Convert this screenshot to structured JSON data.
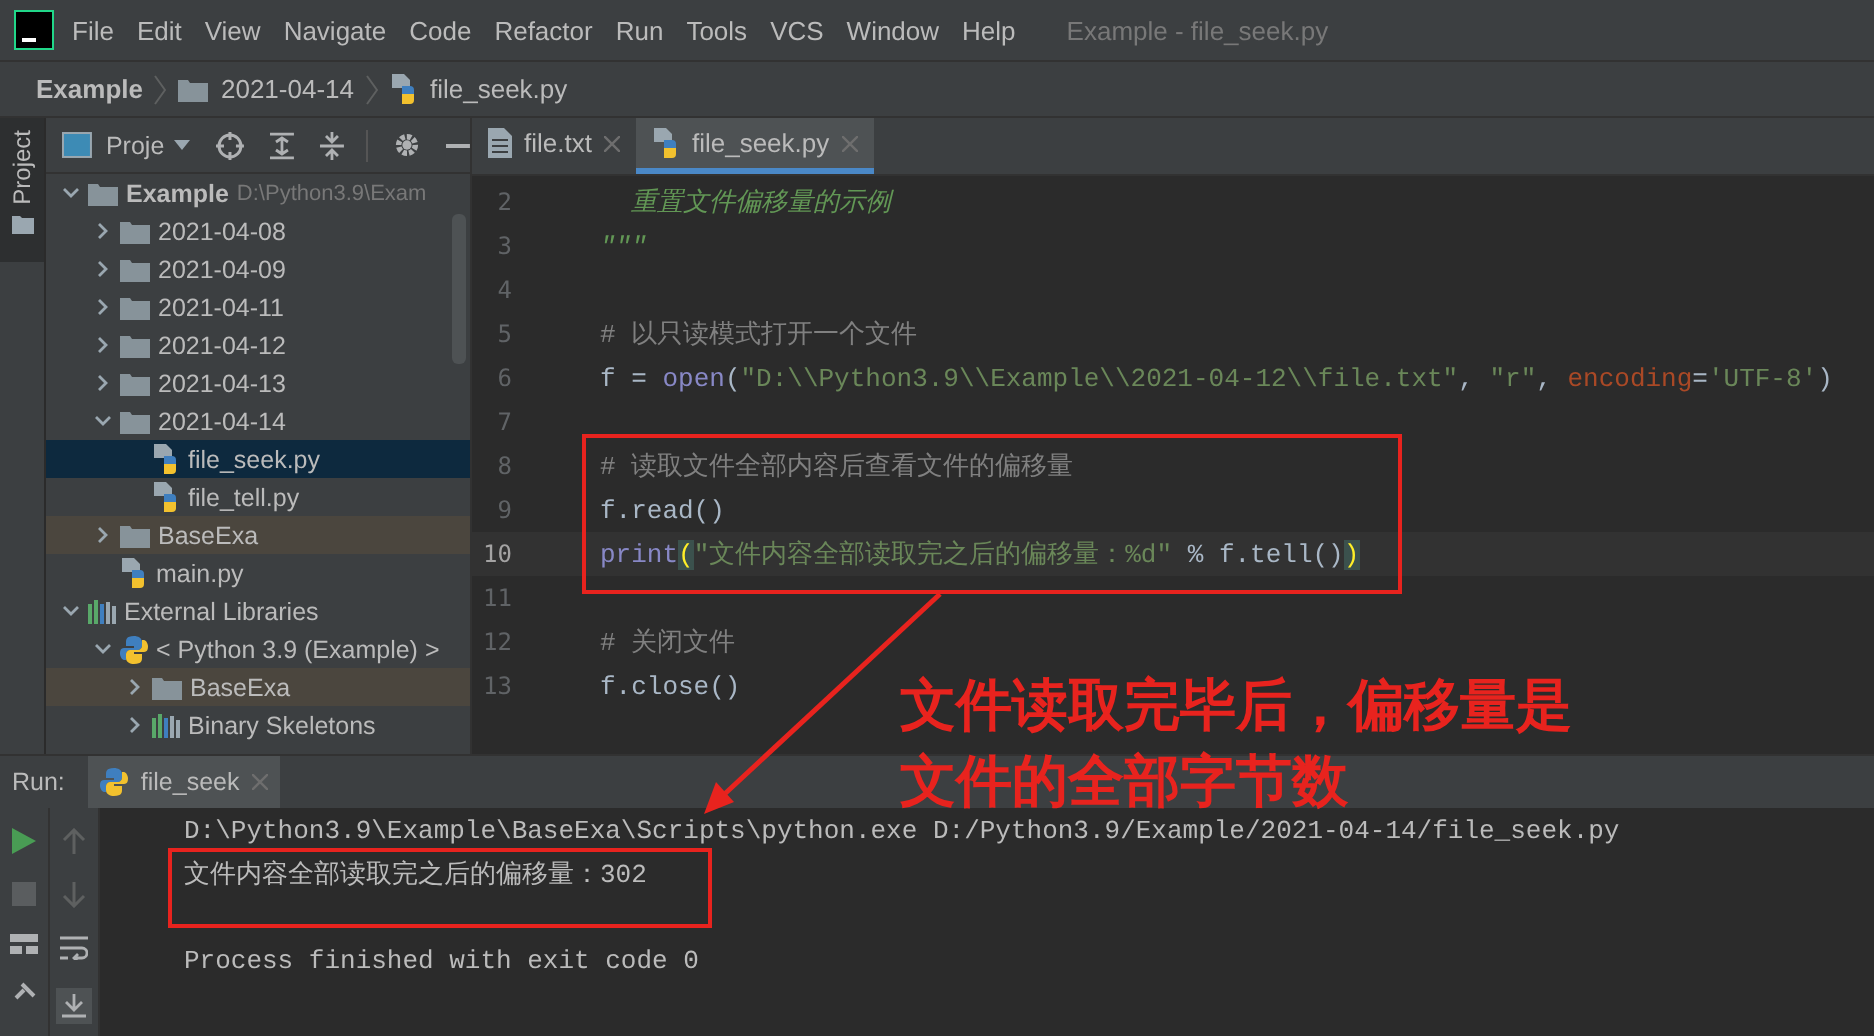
{
  "window": {
    "title": "Example - file_seek.py"
  },
  "menu": [
    "File",
    "Edit",
    "View",
    "Navigate",
    "Code",
    "Refactor",
    "Run",
    "Tools",
    "VCS",
    "Window",
    "Help"
  ],
  "breadcrumb": [
    {
      "label": "Example",
      "kind": "project"
    },
    {
      "label": "2021-04-14",
      "kind": "folder"
    },
    {
      "label": "file_seek.py",
      "kind": "python"
    }
  ],
  "side_tab": {
    "label": "Project"
  },
  "project_panel": {
    "title": "Proje"
  },
  "tree": [
    {
      "label": "Example",
      "hint": "D:\\Python3.9\\Exam",
      "kind": "folder",
      "expanded": true,
      "selected": false,
      "highlighted": false,
      "children": [
        {
          "label": "2021-04-08",
          "kind": "folder",
          "expanded": false,
          "selected": false,
          "highlighted": false
        },
        {
          "label": "2021-04-09",
          "kind": "folder",
          "expanded": false,
          "selected": false,
          "highlighted": false
        },
        {
          "label": "2021-04-11",
          "kind": "folder",
          "expanded": false,
          "selected": false,
          "highlighted": false
        },
        {
          "label": "2021-04-12",
          "kind": "folder",
          "expanded": false,
          "selected": false,
          "highlighted": false
        },
        {
          "label": "2021-04-13",
          "kind": "folder",
          "expanded": false,
          "selected": false,
          "highlighted": false
        },
        {
          "label": "2021-04-14",
          "kind": "folder",
          "expanded": true,
          "selected": false,
          "highlighted": false,
          "children": [
            {
              "label": "file_seek.py",
              "kind": "python",
              "selected": true,
              "highlighted": false
            },
            {
              "label": "file_tell.py",
              "kind": "python",
              "selected": false,
              "highlighted": false
            }
          ]
        },
        {
          "label": "BaseExa",
          "kind": "folder",
          "expanded": false,
          "selected": false,
          "highlighted": true
        },
        {
          "label": "main.py",
          "kind": "python",
          "selected": false,
          "highlighted": false
        }
      ]
    },
    {
      "label": "External Libraries",
      "kind": "library",
      "expanded": true,
      "selected": false,
      "highlighted": false,
      "children": [
        {
          "label": "< Python 3.9 (Example) >",
          "kind": "sdk",
          "expanded": true,
          "selected": false,
          "highlighted": false,
          "children": [
            {
              "label": "BaseExa",
              "kind": "folder",
              "expanded": false,
              "selected": false,
              "highlighted": true
            },
            {
              "label": "Binary Skeletons",
              "kind": "library",
              "expanded": false,
              "selected": false,
              "highlighted": false
            }
          ]
        }
      ]
    }
  ],
  "editor": {
    "tabs": [
      {
        "label": "file.txt",
        "kind": "text",
        "selected": false
      },
      {
        "label": "file_seek.py",
        "kind": "python",
        "selected": true
      }
    ],
    "lines": [
      {
        "number": "2",
        "current": false,
        "tokens": [
          {
            "text": "  重置文件偏移量的示例",
            "kind": "doc"
          }
        ]
      },
      {
        "number": "3",
        "current": false,
        "tokens": [
          {
            "text": "\"\"\"",
            "kind": "doc"
          }
        ]
      },
      {
        "number": "4",
        "current": false
      },
      {
        "number": "5",
        "current": false,
        "tokens": [
          {
            "text": "# 以只读模式打开一个文件",
            "kind": "comment"
          }
        ]
      },
      {
        "number": "6",
        "current": false,
        "tokens": [
          {
            "text": "f = ",
            "kind": "plain"
          },
          {
            "text": "open",
            "kind": "builtin"
          },
          {
            "text": "(",
            "kind": "plain"
          },
          {
            "text": "\"D:\\\\Python3.9\\\\Example\\\\2021-04-12\\\\file.txt\"",
            "kind": "string"
          },
          {
            "text": ", ",
            "kind": "plain"
          },
          {
            "text": "\"r\"",
            "kind": "string"
          },
          {
            "text": ", ",
            "kind": "plain"
          },
          {
            "text": "encoding",
            "kind": "param"
          },
          {
            "text": "=",
            "kind": "plain"
          },
          {
            "text": "'UTF-8'",
            "kind": "string"
          },
          {
            "text": ")",
            "kind": "plain"
          }
        ]
      },
      {
        "number": "7",
        "current": false
      },
      {
        "number": "8",
        "current": false,
        "tokens": [
          {
            "text": "# 读取文件全部内容后查看文件的偏移量",
            "kind": "comment"
          }
        ]
      },
      {
        "number": "9",
        "current": false,
        "tokens": [
          {
            "text": "f.read()",
            "kind": "plain"
          }
        ]
      },
      {
        "number": "10",
        "current": true,
        "tokens": [
          {
            "text": "print",
            "kind": "builtin"
          },
          {
            "text": "(",
            "kind": "match"
          },
          {
            "text": "\"文件内容全部读取完之后的偏移量：%d\"",
            "kind": "string"
          },
          {
            "text": " % f.tell()",
            "kind": "plain"
          },
          {
            "text": ")",
            "kind": "match"
          }
        ]
      },
      {
        "number": "11",
        "current": false
      },
      {
        "number": "12",
        "current": false,
        "tokens": [
          {
            "text": "# 关闭文件",
            "kind": "comment"
          }
        ]
      },
      {
        "number": "13",
        "current": false,
        "tokens": [
          {
            "text": "f.close()",
            "kind": "plain"
          }
        ]
      }
    ]
  },
  "run_panel": {
    "label": "Run:",
    "tabs": [
      {
        "label": "file_seek",
        "selected": true
      }
    ],
    "output": [
      "D:\\Python3.9\\Example\\BaseExa\\Scripts\\python.exe D:/Python3.9/Example/2021-04-14/file_seek.py",
      "文件内容全部读取完之后的偏移量：302",
      "Process finished with exit code 0"
    ]
  },
  "annotation": {
    "text_lines": [
      "文件读取完毕后，偏移量是",
      "文件的全部字节数"
    ]
  }
}
